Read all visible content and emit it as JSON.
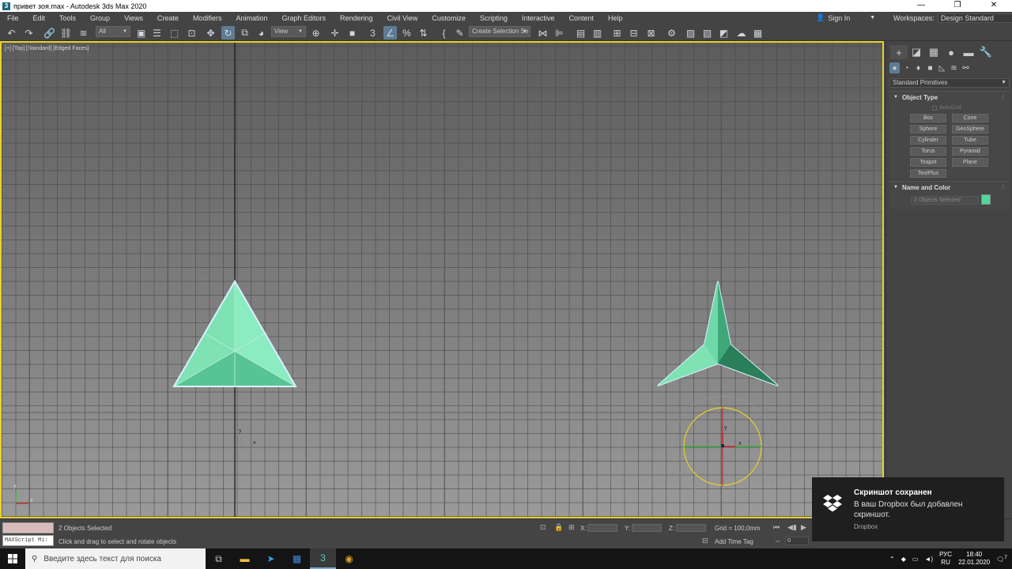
{
  "window": {
    "title": "привет зоя.max - Autodesk 3ds Max 2020",
    "controls": [
      "—",
      "❐",
      "✕"
    ]
  },
  "menu": {
    "items": [
      "File",
      "Edit",
      "Tools",
      "Group",
      "Views",
      "Create",
      "Modifiers",
      "Animation",
      "Graph Editors",
      "Rendering",
      "Civil View",
      "Customize",
      "Scripting",
      "Interactive",
      "Content",
      "Help"
    ],
    "sign_in": "Sign In",
    "workspaces_label": "Workspaces:",
    "workspace_value": "Design Standard"
  },
  "toolbar": {
    "filter_value": "All",
    "refcoord_value": "View",
    "selection_set_placeholder": "Create Selection Se"
  },
  "viewport": {
    "label": "[+] [Top] [Standard] [Edged Faces]",
    "axis_x": "x",
    "axis_y": "y",
    "object_color": "#6fd8a8",
    "border_color": "#e8d22a"
  },
  "command_panel": {
    "primitive_dropdown": "Standard Primitives",
    "object_type": {
      "header": "Object Type",
      "autogrid": "AutoGrid",
      "buttons": [
        "Box",
        "Cone",
        "Sphere",
        "GeoSphere",
        "Cylinder",
        "Tube",
        "Torus",
        "Pyramid",
        "Teapot",
        "Plane",
        "TextPlus"
      ]
    },
    "name_color": {
      "header": "Name and Color",
      "name_value": "2 Objects Selected",
      "swatch_color": "#4fd89a"
    }
  },
  "status": {
    "maxscript_label": "MAXScript Mi:",
    "selection": "2 Objects Selected",
    "prompt": "Click and drag to select and rotate objects",
    "x_label": "X:",
    "y_label": "Y:",
    "z_label": "Z:",
    "grid": "Grid = 100,0mm",
    "add_time_tag": "Add Time Tag",
    "frame": "0"
  },
  "toast": {
    "title": "Скриншот сохранен",
    "body": "В ваш Dropbox был добавлен скриншот.",
    "source": "Dropbox"
  },
  "taskbar": {
    "search_placeholder": "Введите здесь текст для поиска",
    "lang_top": "РУС",
    "lang_bottom": "RU",
    "time": "18:40",
    "date": "22.01.2020",
    "notif_count": "7"
  }
}
